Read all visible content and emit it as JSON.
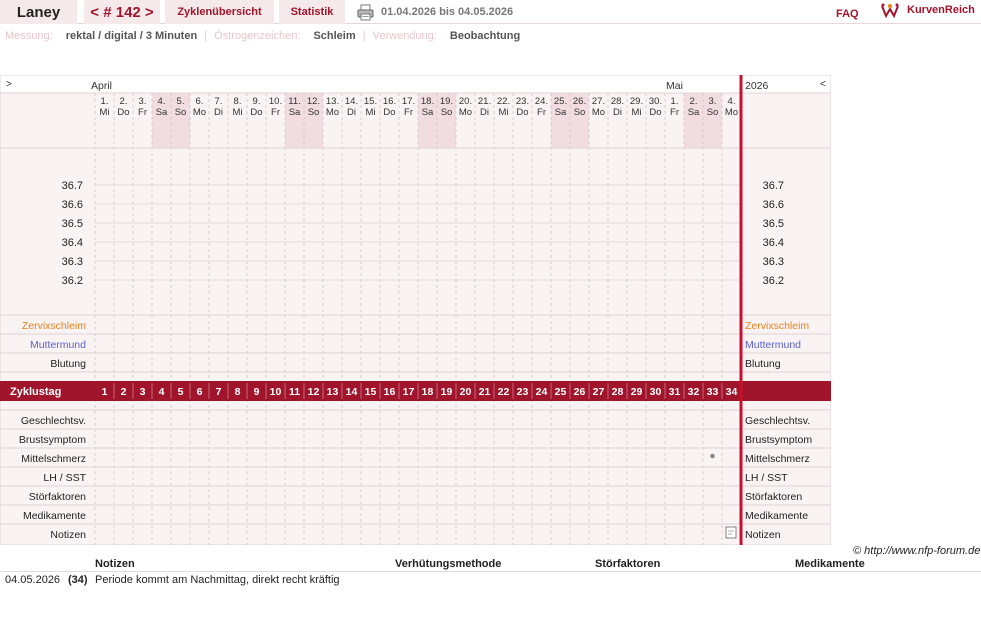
{
  "header": {
    "user_name": "Laney",
    "cycle_label": "< # 142 >",
    "tab_overview": "Zyklenübersicht",
    "tab_statistics": "Statistik",
    "date_range": "01.04.2026 bis 04.05.2026",
    "faq": "FAQ",
    "brand": "KurvenReich"
  },
  "settings": {
    "measurement_label": "Messung:",
    "measurement_value": "rektal / digital / 3 Minuten",
    "estrogen_label": "Östrogenzeichen:",
    "estrogen_value": "Schleim",
    "usage_label": "Verwendung:",
    "usage_value": "Beobachtung"
  },
  "calendar": {
    "nav_prev": ">",
    "nav_next": "<",
    "month_april": "April",
    "month_may": "Mai",
    "year": "2026",
    "days": [
      {
        "d": "1.",
        "w": "Mi",
        "weekend": false
      },
      {
        "d": "2.",
        "w": "Do",
        "weekend": false
      },
      {
        "d": "3.",
        "w": "Fr",
        "weekend": false
      },
      {
        "d": "4.",
        "w": "Sa",
        "weekend": true
      },
      {
        "d": "5.",
        "w": "So",
        "weekend": true
      },
      {
        "d": "6.",
        "w": "Mo",
        "weekend": false
      },
      {
        "d": "7.",
        "w": "Di",
        "weekend": false
      },
      {
        "d": "8.",
        "w": "Mi",
        "weekend": false
      },
      {
        "d": "9.",
        "w": "Do",
        "weekend": false
      },
      {
        "d": "10.",
        "w": "Fr",
        "weekend": false
      },
      {
        "d": "11.",
        "w": "Sa",
        "weekend": true
      },
      {
        "d": "12.",
        "w": "So",
        "weekend": true
      },
      {
        "d": "13.",
        "w": "Mo",
        "weekend": false
      },
      {
        "d": "14.",
        "w": "Di",
        "weekend": false
      },
      {
        "d": "15.",
        "w": "Mi",
        "weekend": false
      },
      {
        "d": "16.",
        "w": "Do",
        "weekend": false
      },
      {
        "d": "17.",
        "w": "Fr",
        "weekend": false
      },
      {
        "d": "18.",
        "w": "Sa",
        "weekend": true
      },
      {
        "d": "19.",
        "w": "So",
        "weekend": true
      },
      {
        "d": "20.",
        "w": "Mo",
        "weekend": false
      },
      {
        "d": "21.",
        "w": "Di",
        "weekend": false
      },
      {
        "d": "22.",
        "w": "Mi",
        "weekend": false
      },
      {
        "d": "23.",
        "w": "Do",
        "weekend": false
      },
      {
        "d": "24.",
        "w": "Fr",
        "weekend": false
      },
      {
        "d": "25.",
        "w": "Sa",
        "weekend": true
      },
      {
        "d": "26.",
        "w": "So",
        "weekend": true
      },
      {
        "d": "27.",
        "w": "Mo",
        "weekend": false
      },
      {
        "d": "28.",
        "w": "Di",
        "weekend": false
      },
      {
        "d": "29.",
        "w": "Mi",
        "weekend": false
      },
      {
        "d": "30.",
        "w": "Do",
        "weekend": false
      },
      {
        "d": "1.",
        "w": "Fr",
        "weekend": false
      },
      {
        "d": "2.",
        "w": "Sa",
        "weekend": true
      },
      {
        "d": "3.",
        "w": "So",
        "weekend": true
      },
      {
        "d": "4.",
        "w": "Mo",
        "weekend": false
      }
    ]
  },
  "temperature_axis": [
    "36.7",
    "36.6",
    "36.5",
    "36.4",
    "36.3",
    "36.2"
  ],
  "observation_rows": [
    {
      "label": "Zervixschleim",
      "color": "#e8821c"
    },
    {
      "label": "Muttermund",
      "color": "#5a63c8"
    },
    {
      "label": "Blutung",
      "color": "#222222"
    }
  ],
  "cycle_day_label": "Zyklustag",
  "cycle_days": [
    "1",
    "2",
    "3",
    "4",
    "5",
    "6",
    "7",
    "8",
    "9",
    "10",
    "11",
    "12",
    "13",
    "14",
    "15",
    "16",
    "17",
    "18",
    "19",
    "20",
    "21",
    "22",
    "23",
    "24",
    "25",
    "26",
    "27",
    "28",
    "29",
    "30",
    "31",
    "32",
    "33",
    "34"
  ],
  "symptom_rows": [
    "Geschlechtsv.",
    "Brustsymptom",
    "Mittelschmerz",
    "LH / SST",
    "Störfaktoren",
    "Medikamente",
    "Notizen"
  ],
  "markers": {
    "mittelschmerz_day": 33,
    "note_day": 34
  },
  "colors": {
    "accent": "#a0152b",
    "weekend": "#f1dde1",
    "chart_bg": "#f9f3f4",
    "today_line": "#c8102e"
  },
  "copyright": "© http://www.nfp-forum.de",
  "notes_table": {
    "headers": [
      "Notizen",
      "Verhütungsmethode",
      "Störfaktoren",
      "Medikamente"
    ],
    "rows": [
      {
        "date": "04.05.2026",
        "cycle_day": "(34)",
        "note": "Periode kommt am Nachmittag, direkt recht kräftig"
      }
    ]
  }
}
